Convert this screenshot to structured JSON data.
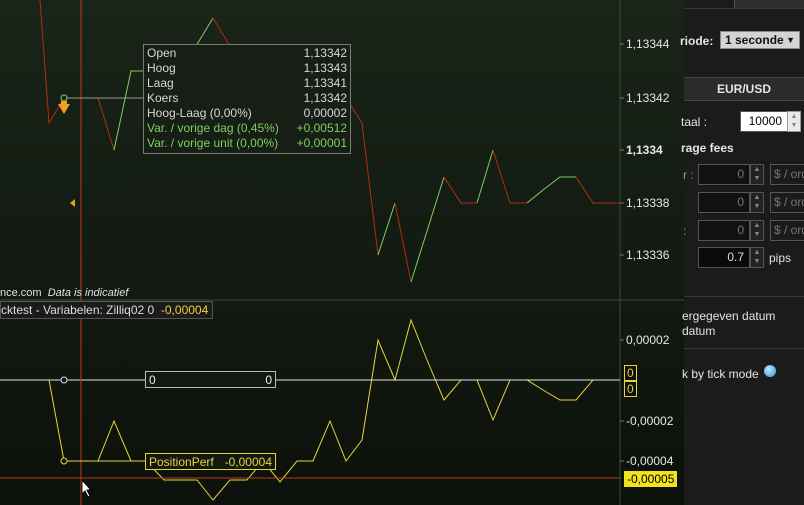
{
  "price_axis": {
    "labels": [
      {
        "text": "1,13344",
        "bold": false
      },
      {
        "text": "1,13342",
        "bold": false
      },
      {
        "text": "1,1334",
        "bold": true
      },
      {
        "text": "1,13338",
        "bold": false
      },
      {
        "text": "1,13336",
        "bold": false
      }
    ]
  },
  "indicator_axis": {
    "labels": [
      "0,00002",
      "-0,00002",
      "-0,00004"
    ]
  },
  "tooltip": {
    "rows": [
      {
        "label": "Open",
        "value": "1,13342"
      },
      {
        "label": "Hoog",
        "value": "1,13343"
      },
      {
        "label": "Laag",
        "value": "1,13341"
      },
      {
        "label": "Koers",
        "value": "1,13342"
      },
      {
        "label": "Hoog-Laag (0,00%)",
        "value": "0,00002"
      }
    ],
    "green_rows": [
      {
        "label": "Var. / vorige dag (0,45%)",
        "value": "+0,00512"
      },
      {
        "label": "Var. / vorige unit (0,00%)",
        "value": "+0,00001"
      }
    ]
  },
  "source": {
    "left": "nce.com",
    "italic": "Data is indicatief"
  },
  "indicator": {
    "title": "cktest - Variabelen: Zilliq02",
    "value1": "0",
    "value2": "-0,00004"
  },
  "boxes": {
    "zero_left": "0",
    "zero_right": "0",
    "pp_label": "PositionPerf",
    "pp_value": "-0,00004"
  },
  "tags": {
    "tag1": "0",
    "tag2": "0",
    "current": "-0,00005"
  },
  "side_panel": {
    "periode_label": "riode:",
    "periode_value": "1 seconde",
    "pair": "EUR/USD",
    "aantal_label": "taal :",
    "aantal_value": "10000",
    "fees_label": "rage fees",
    "fee_rows": [
      {
        "prefix": "r :",
        "value": "0",
        "unit": "$ / ord"
      },
      {
        "prefix": "",
        "value": "0",
        "unit": "$ / ord"
      },
      {
        "prefix": ":",
        "value": "0",
        "unit": "$ / ord"
      }
    ],
    "pips_value": "0.7",
    "pips_label": "pips",
    "date_line1": "ergegeven datum",
    "date_line2": "datum",
    "tick_mode": "k by tick mode"
  },
  "colors": {
    "up": "#7ed15f",
    "down": "#b52a10",
    "indicator": "#e8d43a",
    "crosshair": "#c0391b"
  }
}
